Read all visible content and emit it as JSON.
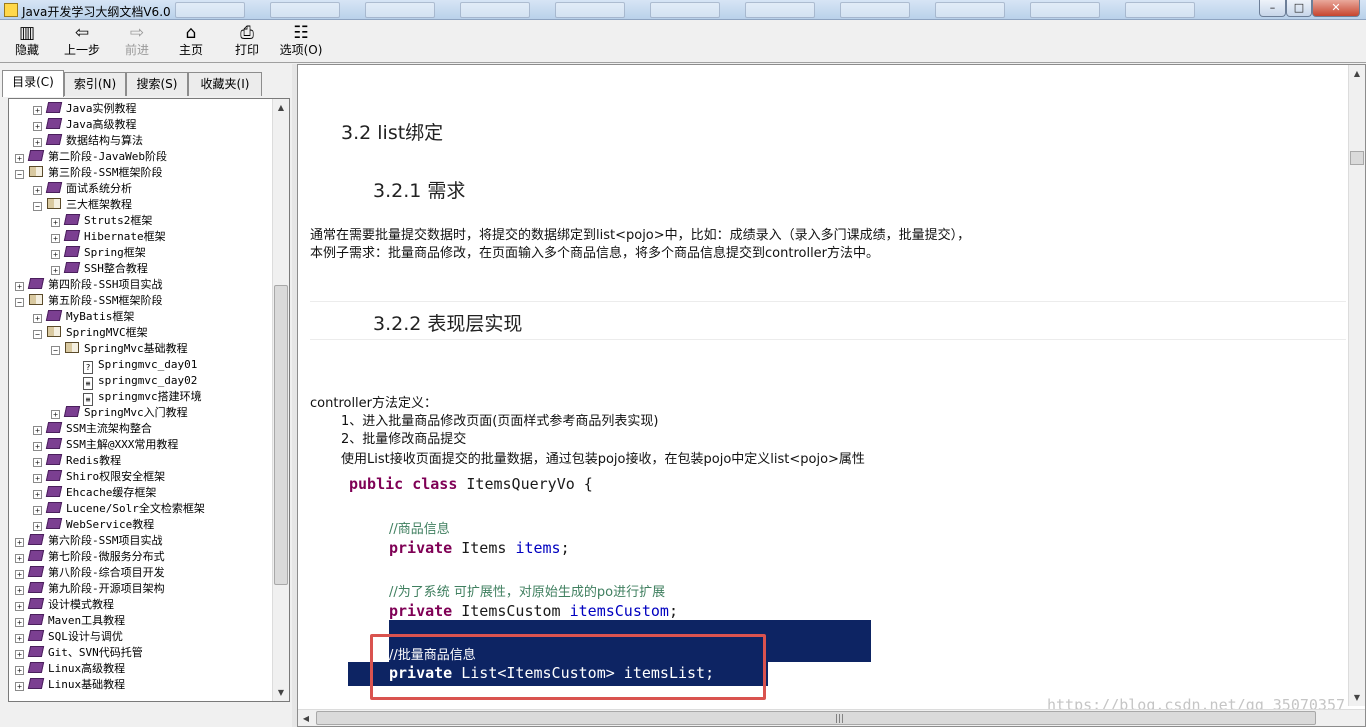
{
  "window": {
    "title": "Java开发学习大纲文档V6.0",
    "caption_buttons": {
      "minimize": "–",
      "maximize": "□",
      "close": "✕"
    }
  },
  "toolbar": {
    "hide": "隐藏",
    "back": "上一步",
    "forward": "前进",
    "home": "主页",
    "print": "打印",
    "options": "选项(O)"
  },
  "tabs": {
    "contents": "目录(C)",
    "index": "索引(N)",
    "search": "搜索(S)",
    "favorites": "收藏夹(I)"
  },
  "tree": [
    {
      "label": "Java实例教程",
      "level": 1,
      "node": "book"
    },
    {
      "label": "Java高级教程",
      "level": 1,
      "node": "book"
    },
    {
      "label": "数据结构与算法",
      "level": 1,
      "node": "book"
    },
    {
      "label": "第二阶段-JavaWeb阶段",
      "level": 0,
      "node": "book"
    },
    {
      "label": "第三阶段-SSM框架阶段",
      "level": 0,
      "node": "open"
    },
    {
      "label": "面试系统分析",
      "level": 1,
      "node": "book"
    },
    {
      "label": "三大框架教程",
      "level": 1,
      "node": "open"
    },
    {
      "label": "Struts2框架",
      "level": 2,
      "node": "book"
    },
    {
      "label": "Hibernate框架",
      "level": 2,
      "node": "book"
    },
    {
      "label": "Spring框架",
      "level": 2,
      "node": "book"
    },
    {
      "label": "SSH整合教程",
      "level": 2,
      "node": "book"
    },
    {
      "label": "第四阶段-SSH项目实战",
      "level": 0,
      "node": "book"
    },
    {
      "label": "第五阶段-SSM框架阶段",
      "level": 0,
      "node": "open"
    },
    {
      "label": "MyBatis框架",
      "level": 1,
      "node": "book"
    },
    {
      "label": "SpringMVC框架",
      "level": 1,
      "node": "open"
    },
    {
      "label": "SpringMvc基础教程",
      "level": 2,
      "node": "open"
    },
    {
      "label": "Springmvc_day01",
      "level": 3,
      "node": "page-q"
    },
    {
      "label": "springmvc_day02",
      "level": 3,
      "node": "page"
    },
    {
      "label": "springmvc搭建环境",
      "level": 3,
      "node": "page"
    },
    {
      "label": "SpringMvc入门教程",
      "level": 2,
      "node": "book"
    },
    {
      "label": "SSM主流架构整合",
      "level": 1,
      "node": "book"
    },
    {
      "label": "SSM主解@XXX常用教程",
      "level": 1,
      "node": "book"
    },
    {
      "label": "Redis教程",
      "level": 1,
      "node": "book"
    },
    {
      "label": "Shiro权限安全框架",
      "level": 1,
      "node": "book"
    },
    {
      "label": "Ehcache缓存框架",
      "level": 1,
      "node": "book"
    },
    {
      "label": "Lucene/Solr全文检索框架",
      "level": 1,
      "node": "book"
    },
    {
      "label": "WebService教程",
      "level": 1,
      "node": "book"
    },
    {
      "label": "第六阶段-SSM项目实战",
      "level": 0,
      "node": "book"
    },
    {
      "label": "第七阶段-微服务分布式",
      "level": 0,
      "node": "book"
    },
    {
      "label": "第八阶段-综合项目开发",
      "level": 0,
      "node": "book"
    },
    {
      "label": "第九阶段-开源项目架构",
      "level": 0,
      "node": "book"
    },
    {
      "label": "设计模式教程",
      "level": 0,
      "node": "book"
    },
    {
      "label": "Maven工具教程",
      "level": 0,
      "node": "book"
    },
    {
      "label": "SQL设计与调优",
      "level": 0,
      "node": "book"
    },
    {
      "label": "Git、SVN代码托管",
      "level": 0,
      "node": "book"
    },
    {
      "label": "Linux高级教程",
      "level": 0,
      "node": "book"
    },
    {
      "label": "Linux基础教程",
      "level": 0,
      "node": "book"
    }
  ],
  "content": {
    "h_3_2": "3.2  list绑定",
    "h_3_2_1": "3.2.1  需求",
    "req_line1": "通常在需要批量提交数据时，将提交的数据绑定到list<pojo>中，比如：成绩录入（录入多门课成绩，批量提交），",
    "req_line2": "本例子需求：批量商品修改，在页面输入多个商品信息，将多个商品信息提交到controller方法中。",
    "h_3_2_2": "3.2.2  表现层实现",
    "ctrl_title": "controller方法定义：",
    "ctrl_item1": "1、进入批量商品修改页面(页面样式参考商品列表实现)",
    "ctrl_item2": "2、批量修改商品提交",
    "ctrl_desc": "使用List接收页面提交的批量数据，通过包装pojo接收，在包装pojo中定义list<pojo>属性",
    "code": {
      "l1_kw": "public class ",
      "l1_rest": "ItemsQueryVo {",
      "c1": "//商品信息",
      "l2_kw": "private ",
      "l2_type": "Items ",
      "l2_field": "items",
      "l2_end": ";",
      "c2": "//为了系统 可扩展性，对原始生成的po进行扩展",
      "l3_kw": "private ",
      "l3_type": "ItemsCustom ",
      "l3_field": "itemsCustom",
      "l3_end": ";",
      "c3": "//批量商品信息",
      "l4_kw": "private ",
      "l4_rest": "List<ItemsCustom> itemsList;"
    },
    "watermark": "https://blog.csdn.net/qq_35070357"
  }
}
